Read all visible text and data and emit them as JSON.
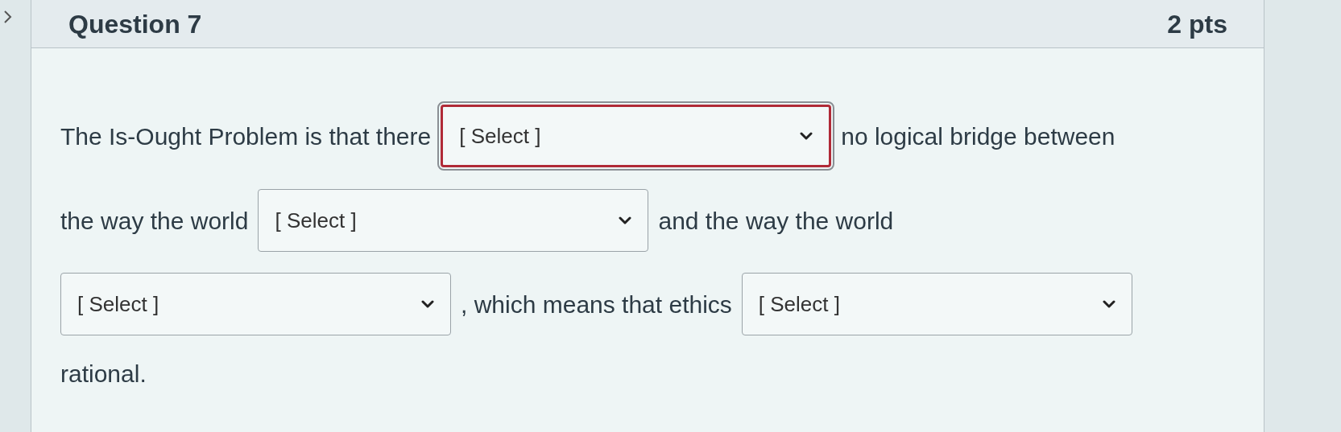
{
  "question": {
    "title": "Question 7",
    "points": "2 pts"
  },
  "lines": [
    [
      {
        "kind": "text",
        "text": "The Is-Ought Problem is that there"
      },
      {
        "kind": "select",
        "value": "[ Select ]",
        "focused": true
      },
      {
        "kind": "text",
        "text": "no logical bridge between"
      }
    ],
    [
      {
        "kind": "text",
        "text": "the way the world"
      },
      {
        "kind": "select",
        "value": "[ Select ]",
        "focused": false
      },
      {
        "kind": "text",
        "text": "and the way the world"
      }
    ],
    [
      {
        "kind": "select",
        "value": "[ Select ]",
        "focused": false
      },
      {
        "kind": "text",
        "text": ", which means that ethics"
      },
      {
        "kind": "select",
        "value": "[ Select ]",
        "focused": false
      }
    ],
    [
      {
        "kind": "text",
        "text": "rational."
      }
    ]
  ]
}
